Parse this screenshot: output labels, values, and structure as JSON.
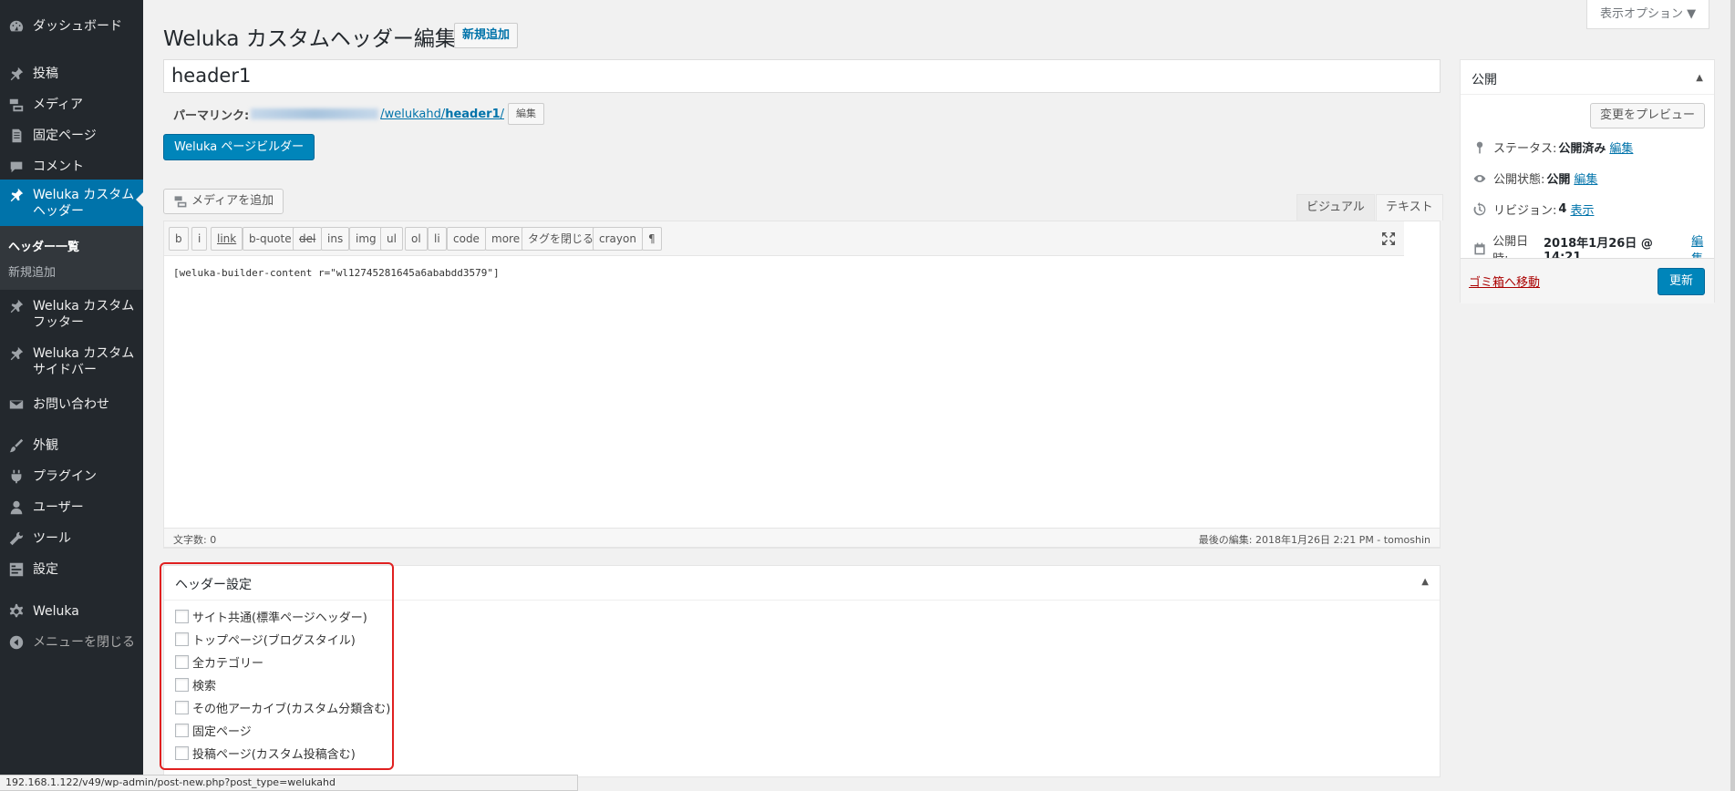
{
  "sidebar": {
    "items": [
      {
        "label": "ダッシュボード",
        "icon": "dashboard-icon"
      },
      {
        "label": "投稿",
        "icon": "pin-icon"
      },
      {
        "label": "メディア",
        "icon": "media-icon"
      },
      {
        "label": "固定ページ",
        "icon": "page-icon"
      },
      {
        "label": "コメント",
        "icon": "comment-icon"
      },
      {
        "label": "Weluka カスタムヘッダー",
        "icon": "pin-icon"
      },
      {
        "label": "Weluka カスタムフッター",
        "icon": "pin-icon"
      },
      {
        "label": "Weluka カスタムサイドバー",
        "icon": "pin-icon"
      },
      {
        "label": "お問い合わせ",
        "icon": "mail-icon"
      },
      {
        "label": "外観",
        "icon": "brush-icon"
      },
      {
        "label": "プラグイン",
        "icon": "plugin-icon"
      },
      {
        "label": "ユーザー",
        "icon": "user-icon"
      },
      {
        "label": "ツール",
        "icon": "wrench-icon"
      },
      {
        "label": "設定",
        "icon": "settings-icon"
      },
      {
        "label": "Weluka",
        "icon": "gear-icon"
      },
      {
        "label": "メニューを閉じる",
        "icon": "collapse-icon"
      }
    ],
    "submenu": [
      {
        "label": "ヘッダー一覧"
      },
      {
        "label": "新規追加"
      }
    ]
  },
  "header": {
    "title": "Weluka カスタムヘッダー編集",
    "add_new": "新規追加",
    "screen_options": "表示オプション ▼"
  },
  "post": {
    "title_value": "header1",
    "permalink_label": "パーマリンク:",
    "permalink_path": "/welukahd/",
    "permalink_slug": "header1",
    "permalink_edit": "編集",
    "builder_button": "Weluka ページビルダー"
  },
  "editor": {
    "add_media": "メディアを追加",
    "tab_visual": "ビジュアル",
    "tab_text": "テキスト",
    "buttons": [
      "b",
      "i",
      "link",
      "b-quote",
      "del",
      "ins",
      "img",
      "ul",
      "ol",
      "li",
      "code",
      "more",
      "タグを閉じる",
      "crayon",
      "¶"
    ],
    "content": "[weluka-builder-content r=\"wl12745281645a6ababdd3579\"]",
    "word_count": "文字数: 0",
    "last_edit": "最後の編集: 2018年1月26日 2:21 PM - tomoshin"
  },
  "header_settings": {
    "title": "ヘッダー設定",
    "toggle": "▲",
    "options": [
      "サイト共通(標準ページヘッダー)",
      "トップページ(ブログスタイル)",
      "全カテゴリー",
      "検索",
      "その他アーカイブ(カスタム分類含む)",
      "固定ページ",
      "投稿ページ(カスタム投稿含む)"
    ]
  },
  "publish": {
    "title": "公開",
    "toggle": "▲",
    "preview_button": "変更をプレビュー",
    "status_label": "ステータス:",
    "status_value": "公開済み",
    "status_edit": "編集",
    "visibility_label": "公開状態:",
    "visibility_value": "公開",
    "visibility_edit": "編集",
    "revision_label": "リビジョン:",
    "revision_value": "4",
    "revision_link": "表示",
    "date_label": "公開日時:",
    "date_value": "2018年1月26日 @ 14:21",
    "date_edit": "編集",
    "trash": "ゴミ箱へ移動",
    "update": "更新"
  },
  "status_url": "192.168.1.122/v49/wp-admin/post-new.php?post_type=welukahd",
  "colors": {
    "sidebar_bg": "#23282d",
    "accent": "#0073aa",
    "primary_button": "#0085ba",
    "highlight_box": "#e02020"
  }
}
